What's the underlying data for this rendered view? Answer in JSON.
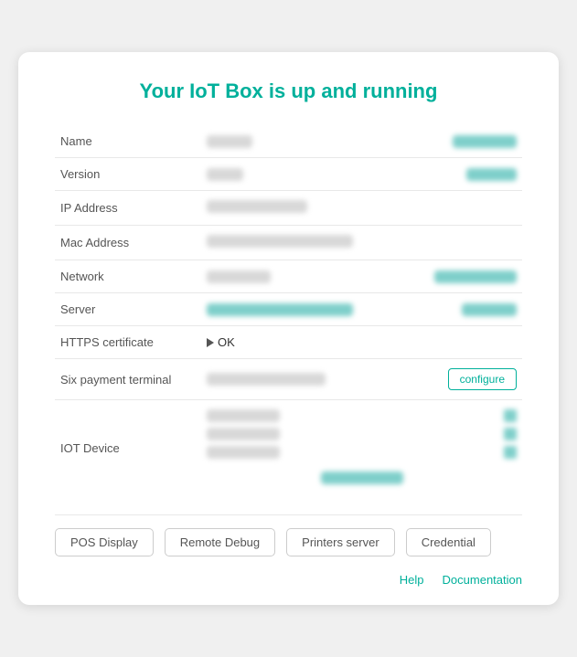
{
  "page": {
    "title": "Your IoT Box is up and running"
  },
  "fields": {
    "name_label": "Name",
    "version_label": "Version",
    "ip_address_label": "IP Address",
    "mac_address_label": "Mac Address",
    "network_label": "Network",
    "server_label": "Server",
    "https_label": "HTTPS certificate",
    "six_payment_label": "Six payment terminal",
    "iot_device_label": "IOT Device",
    "https_status": "OK",
    "configure_label": "configure"
  },
  "footer_buttons": {
    "pos_display": "POS Display",
    "remote_debug": "Remote Debug",
    "printers_server": "Printers server",
    "credential": "Credential"
  },
  "footer_links": {
    "help": "Help",
    "documentation": "Documentation"
  }
}
